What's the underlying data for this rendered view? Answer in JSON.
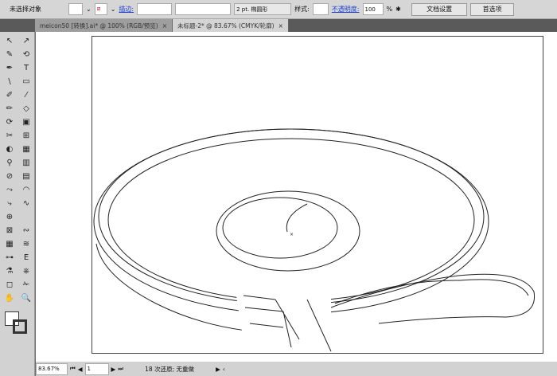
{
  "control_bar": {
    "selection": "未选择对象",
    "stroke_label": "描边:",
    "stroke_value": "",
    "brush": "2 pt. 椭圆形",
    "style_label": "样式:",
    "opacity_label": "不透明度:",
    "opacity_value": "100",
    "opacity_unit": "%",
    "doc_setup": "文档设置",
    "preferences": "首选项"
  },
  "tabs": [
    {
      "label": "meicon50 [转换].ai* @ 100% (RGB/预览)",
      "active": false
    },
    {
      "label": "未标题-2* @ 83.67% (CMYK/轮廓)",
      "active": true
    }
  ],
  "tools": [
    "↖",
    "↗",
    "✎",
    "⟲",
    "✒",
    "T",
    "\\",
    "▭",
    "✐",
    "⁄",
    "✏",
    "◇",
    "⟳",
    "▣",
    "✂",
    "⊞",
    "◐",
    "▦",
    "⚲",
    "▥",
    "⊘",
    "▤",
    "⤳",
    "◠",
    "⤷",
    "∿",
    "⊕",
    "",
    "⊠",
    "∾",
    "▦",
    "≋",
    "⊶",
    "E",
    "⚗",
    "⎈",
    "◻",
    "✁",
    "✋",
    "🔍"
  ],
  "status": {
    "zoom": "83.67%",
    "page": "1",
    "message": "18 次还原; 无重做"
  },
  "colors": {
    "accent_link": "#1d3fd0",
    "panel": "#d6d6d6"
  }
}
